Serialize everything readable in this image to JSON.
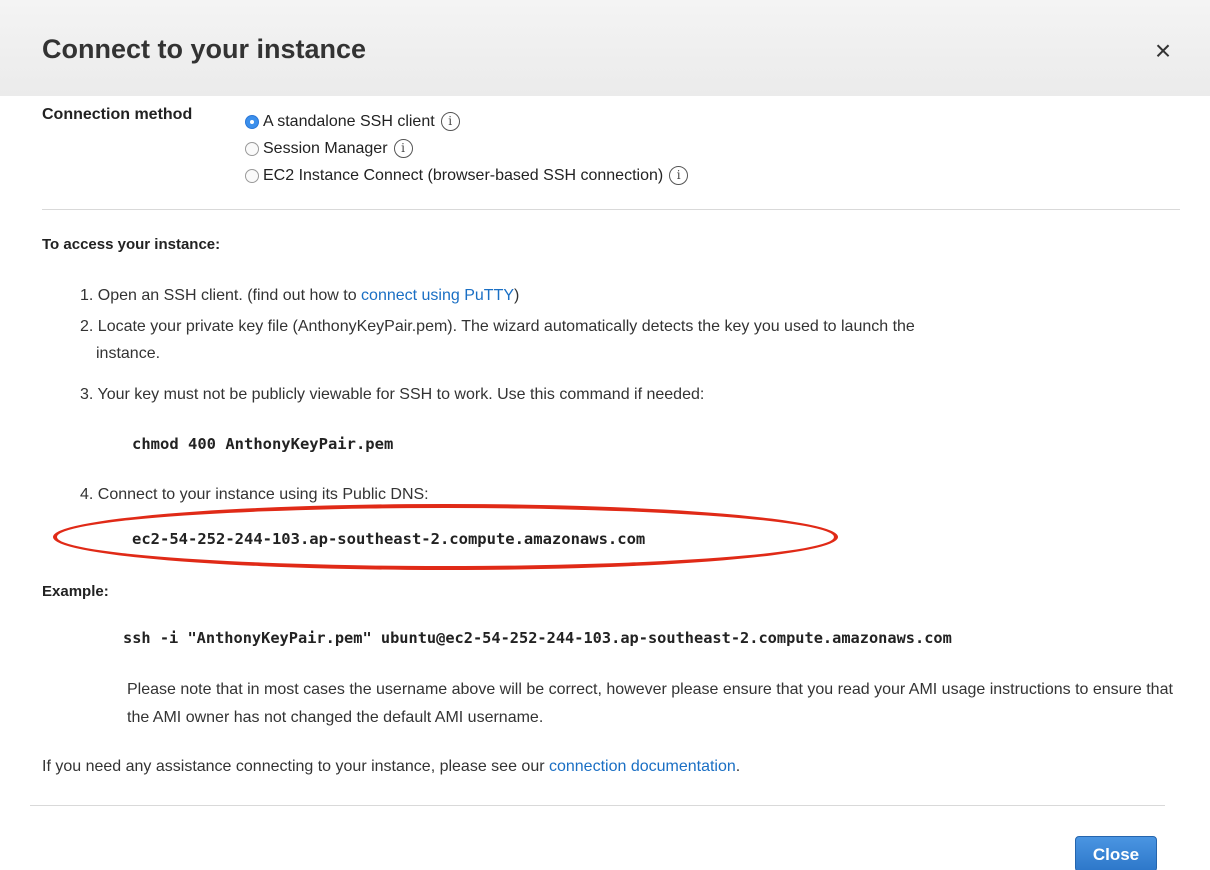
{
  "dialog": {
    "title": "Connect to your instance",
    "close_icon": "×"
  },
  "connection_method": {
    "label": "Connection method",
    "options": [
      {
        "label": "A standalone SSH client",
        "selected": true
      },
      {
        "label": "Session Manager",
        "selected": false
      },
      {
        "label": "EC2 Instance Connect (browser-based SSH connection)",
        "selected": false
      }
    ],
    "info_glyph": "i"
  },
  "instructions": {
    "title": "To access your instance:",
    "step1_prefix": "1. Open an SSH client. (find out how to ",
    "step1_link": "connect using PuTTY",
    "step1_suffix": ")",
    "step2_line1": "2. Locate your private key file (AnthonyKeyPair.pem). The wizard automatically detects the key you used to launch the",
    "step2_line2": "instance.",
    "step3": "3. Your key must not be publicly viewable for SSH to work. Use this command if needed:",
    "chmod_command": "chmod 400 AnthonyKeyPair.pem",
    "step4": "4. Connect to your instance using its Public DNS:",
    "public_dns": "ec2-54-252-244-103.ap-southeast-2.compute.amazonaws.com"
  },
  "example": {
    "label": "Example:",
    "command": "ssh -i \"AnthonyKeyPair.pem\" ubuntu@ec2-54-252-244-103.ap-southeast-2.compute.amazonaws.com",
    "note": "Please note that in most cases the username above will be correct, however please ensure that you read your AMI usage instructions to ensure that the AMI owner has not changed the default AMI username."
  },
  "assistance": {
    "prefix": "If you need any assistance connecting to your instance, please see our ",
    "link": "connection documentation",
    "suffix": "."
  },
  "footer": {
    "close_label": "Close"
  },
  "colors": {
    "link": "#1a6fc4",
    "primary_button": "#2d77c9",
    "highlight_ellipse": "#e02a17"
  }
}
